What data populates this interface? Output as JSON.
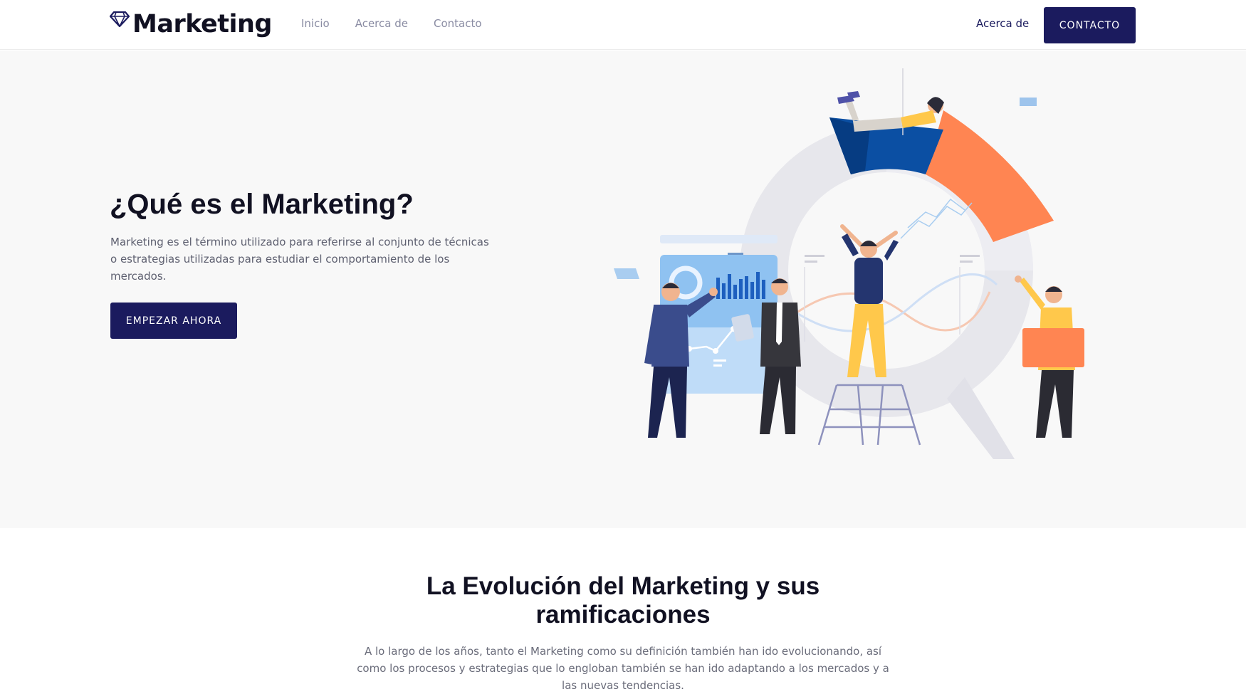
{
  "brand": {
    "name": "Marketing",
    "icon": "diamond-icon",
    "color": "#1b1b5e"
  },
  "nav": {
    "links": [
      "Inicio",
      "Acerca de",
      "Contacto"
    ],
    "right_link": "Acerca de",
    "cta": "CONTACTO"
  },
  "hero": {
    "title": "¿Qué es el Marketing?",
    "description": "Marketing es el término utilizado para referirse al conjunto de técnicas o estrategias utilizadas para estudiar el comportamiento de los mercados.",
    "button": "EMPEZAR AHORA",
    "illustration": "marketing-team-illustration"
  },
  "section2": {
    "title": "La Evolución del Marketing y sus ramificaciones",
    "description": "A lo largo de los años, tanto el Marketing como su definición también han ido evolucionando, así como los procesos y estrategias que lo engloban también se han ido adaptando a los mercados y a las nuevas tendencias."
  },
  "colors": {
    "primary": "#1b1b5e",
    "hero_bg": "#f8f8f8",
    "accent_orange": "#ff8552",
    "accent_blue": "#0b4fa3"
  }
}
